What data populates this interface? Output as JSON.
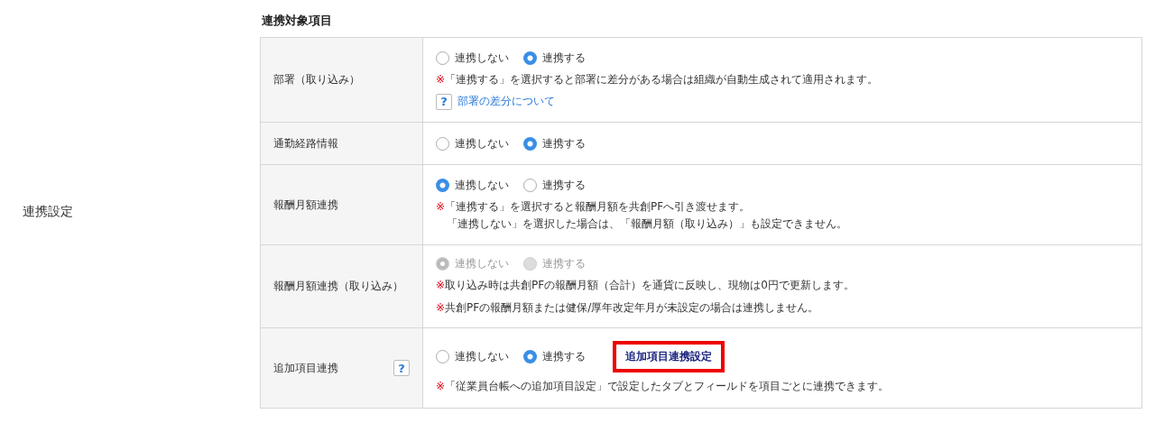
{
  "setting_label": "連携設定",
  "section_title": "連携対象項目",
  "rows": [
    {
      "label": "部署（取り込み）",
      "disabled": false,
      "options": [
        {
          "label": "連携しない",
          "selected": false
        },
        {
          "label": "連携する",
          "selected": true
        }
      ],
      "notes": [
        {
          "mark": "※",
          "lines": [
            "「連携する」を選択すると部署に差分がある場合は組織が自動生成されて適用されます。"
          ]
        }
      ],
      "link": {
        "icon": "?",
        "text": "部署の差分について"
      }
    },
    {
      "label": "通勤経路情報",
      "disabled": false,
      "options": [
        {
          "label": "連携しない",
          "selected": false
        },
        {
          "label": "連携する",
          "selected": true
        }
      ]
    },
    {
      "label": "報酬月額連携",
      "disabled": false,
      "options": [
        {
          "label": "連携しない",
          "selected": true
        },
        {
          "label": "連携する",
          "selected": false
        }
      ],
      "notes": [
        {
          "mark": "※",
          "lines": [
            "「連携する」を選択すると報酬月額を共創PFへ引き渡せます。",
            "「連携しない」を選択した場合は、「報酬月額（取り込み）」も設定できません。"
          ]
        }
      ]
    },
    {
      "label": "報酬月額連携（取り込み）",
      "disabled": true,
      "options": [
        {
          "label": "連携しない",
          "selected": true
        },
        {
          "label": "連携する",
          "selected": false
        }
      ],
      "notes": [
        {
          "mark": "※",
          "lines": [
            "取り込み時は共創PFの報酬月額（合計）を通貨に反映し、現物は0円で更新します。"
          ]
        },
        {
          "mark": "※",
          "lines": [
            "共創PFの報酬月額または健保/厚年改定年月が未設定の場合は連携しません。"
          ]
        }
      ]
    },
    {
      "label": "追加項目連携",
      "help_icon": "?",
      "disabled": false,
      "options": [
        {
          "label": "連携しない",
          "selected": false
        },
        {
          "label": "連携する",
          "selected": true
        }
      ],
      "action": {
        "label": "追加項目連携設定",
        "highlighted": true
      },
      "notes": [
        {
          "mark": "※",
          "lines": [
            "「従業員台帳への追加項目設定」で設定したタブとフィールドを項目ごとに連携できます。"
          ]
        }
      ]
    }
  ]
}
